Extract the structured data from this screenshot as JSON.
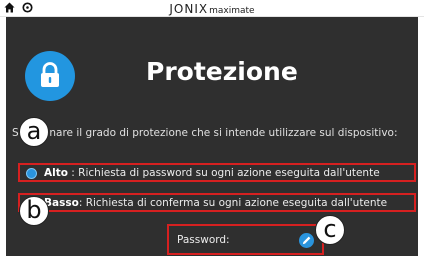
{
  "header": {
    "brand_main": "JONIX",
    "brand_sub": "maximate",
    "icons": [
      "home-icon",
      "settings-icon"
    ]
  },
  "page": {
    "title": "Protezione",
    "icon": "lock-icon",
    "instruction": "Selezionare il grado di protezione che si intende utilizzare sul dispositivo:"
  },
  "options": [
    {
      "label": "Alto",
      "description": " : Richiesta di password su ogni azione eseguita dall'utente",
      "selected": true
    },
    {
      "label": "Basso",
      "description": ": Richiesta di conferma su ogni azione eseguita dall'utente",
      "selected": false
    }
  ],
  "password": {
    "label": "Password:",
    "icon": "pencil-icon"
  },
  "markers": [
    "a",
    "b",
    "c"
  ],
  "colors": {
    "panel_bg": "#2f2f2f",
    "accent_blue": "#2296e0",
    "highlight_red": "#d62020"
  }
}
